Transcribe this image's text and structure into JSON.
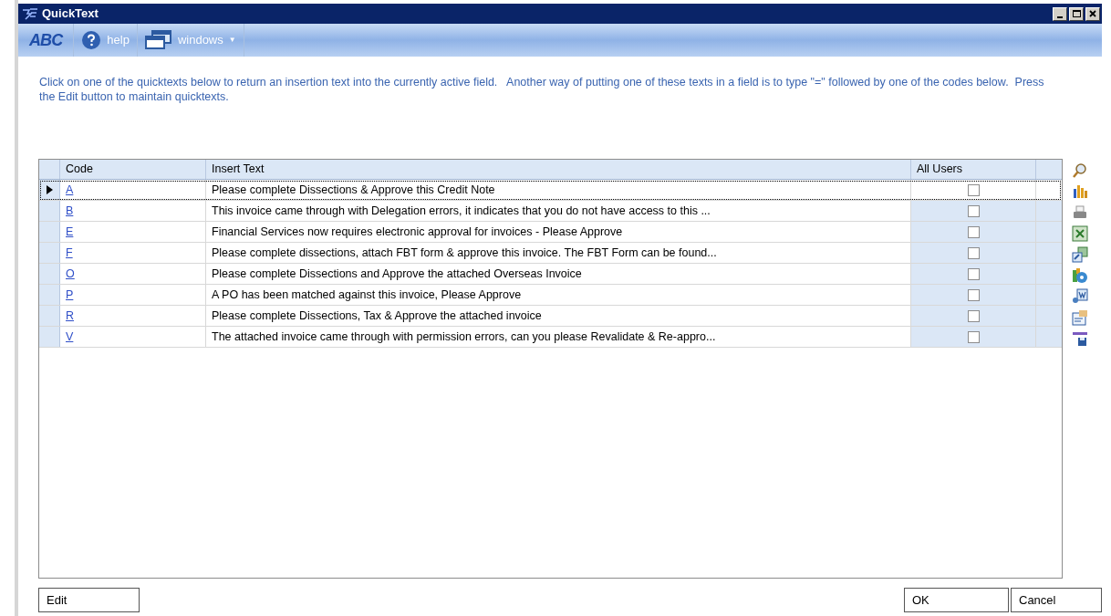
{
  "window": {
    "title": "QuickText"
  },
  "toolbar": [
    {
      "kind": "abc",
      "label": "ABC"
    },
    {
      "kind": "help",
      "label": "help"
    },
    {
      "kind": "windows",
      "label": "windows",
      "caret": "▼"
    }
  ],
  "instructions": "Click on one of the quicktexts below to return an insertion text into the currently active field.   Another way of putting one of these texts in a field is to type \"=\" followed by one of the codes below.  Press the Edit button to maintain quicktexts.",
  "table": {
    "columns": [
      "Code",
      "Insert Text",
      "All Users"
    ],
    "rows": [
      {
        "code": "A",
        "text": "Please complete Dissections & Approve this Credit Note",
        "all_users": false,
        "selected": true
      },
      {
        "code": "B",
        "text": "This invoice came through with Delegation errors, it indicates that you do not have access to this ...",
        "all_users": false,
        "selected": false
      },
      {
        "code": "E",
        "text": "Financial Services now requires electronic approval for invoices - Please Approve",
        "all_users": false,
        "selected": false
      },
      {
        "code": "F",
        "text": "Please complete dissections, attach FBT form & approve this invoice. The FBT Form can be found...",
        "all_users": false,
        "selected": false
      },
      {
        "code": "O",
        "text": "Please complete Dissections and Approve the attached Overseas Invoice",
        "all_users": false,
        "selected": false
      },
      {
        "code": "P",
        "text": "A PO has been matched against this invoice, Please Approve",
        "all_users": false,
        "selected": false
      },
      {
        "code": "R",
        "text": "Please complete Dissections, Tax & Approve the attached invoice",
        "all_users": false,
        "selected": false
      },
      {
        "code": "V",
        "text": "The attached invoice came through with permission errors, can you please Revalidate & Re-appro...",
        "all_users": false,
        "selected": false
      }
    ]
  },
  "side_tools": [
    {
      "kind": "search"
    },
    {
      "kind": "chart"
    },
    {
      "kind": "printer"
    },
    {
      "kind": "excel"
    },
    {
      "kind": "export"
    },
    {
      "kind": "pie"
    },
    {
      "kind": "word"
    },
    {
      "kind": "mail"
    },
    {
      "kind": "save"
    }
  ],
  "buttons": {
    "left": [
      "Edit"
    ],
    "right": [
      "OK",
      "Cancel"
    ]
  }
}
